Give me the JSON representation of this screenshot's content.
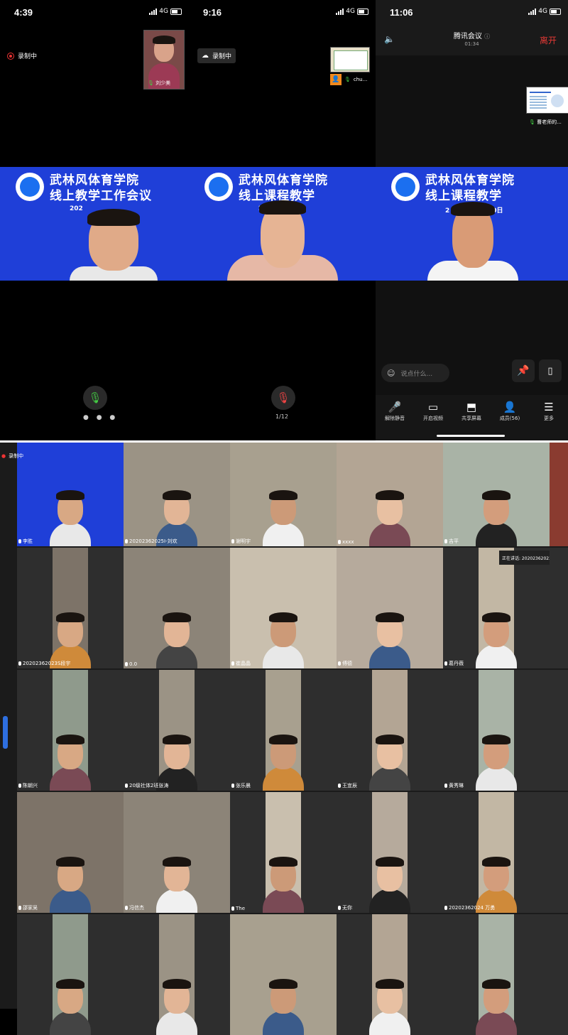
{
  "panel1": {
    "time": "4:39",
    "network": "4G",
    "recording": "录制中",
    "pip_name": "刘少美",
    "banner_line1": "武林风体育学院",
    "banner_line2": "线上教学工作会议",
    "banner_date": "202"
  },
  "panel2": {
    "time": "9:16",
    "network": "4G",
    "recording": "录制中",
    "pip_name": "chu...",
    "banner_line1": "武林风体育学院",
    "banner_line2": "线上课程教学",
    "banner_date": "20",
    "page_indicator": "1/12"
  },
  "panel3": {
    "time": "11:06",
    "network": "4G",
    "app_title": "腾讯会议",
    "info_icon": "ⓘ",
    "duration": "01:34",
    "leave_label": "离开",
    "pip_name": "曹老师的...",
    "banner_line1": "武林风体育学院",
    "banner_line2": "线上课程教学",
    "banner_date": "2",
    "banner_date_tail": "-30日",
    "chat_placeholder": "说点什么...",
    "toolbar": [
      {
        "icon": "mic-muted-icon",
        "glyph": "🎤",
        "label": "解除静音"
      },
      {
        "icon": "camera-off-icon",
        "glyph": "▭",
        "label": "开启视频"
      },
      {
        "icon": "share-screen-icon",
        "glyph": "⬒",
        "label": "共享屏幕"
      },
      {
        "icon": "members-icon",
        "glyph": "👤",
        "label": "成员(56)"
      },
      {
        "icon": "more-icon",
        "glyph": "☰",
        "label": "更多"
      }
    ]
  },
  "grid": {
    "rec_label": "录制中",
    "speaking_label": "正在讲话: 20202362023...",
    "tiles": [
      [
        "李胜",
        "20202362025I-刘欢",
        "谢明宇",
        "xxxx",
        "吉平",
        ""
      ],
      [
        "20202362023S段宇",
        "0.0",
        "崔晶晶",
        "傅德",
        "葛丹薇",
        ""
      ],
      [
        "陈朝兴",
        "20级社体2班张涛",
        "张乐晨",
        "王宜辰",
        "黄秀琳",
        ""
      ],
      [
        "邵家吴",
        "冯信杰",
        "The",
        "无你",
        "20202362024 万勇",
        ""
      ],
      [
        "",
        "",
        "",
        "",
        "",
        ""
      ]
    ]
  }
}
